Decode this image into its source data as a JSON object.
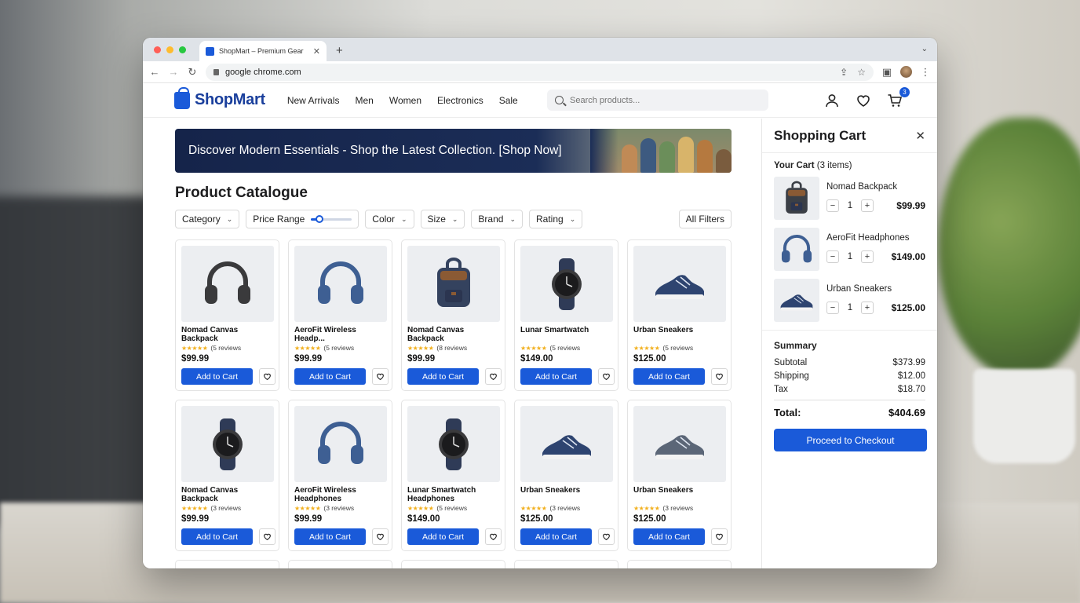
{
  "browser": {
    "tab_title": "ShopMart – Premium Gear",
    "tab_close": "✕",
    "new_tab": "+",
    "url": "google chrome.com"
  },
  "site": {
    "logo": "ShopMart",
    "nav": [
      "New Arrivals",
      "Men",
      "Women",
      "Electronics",
      "Sale"
    ],
    "search_placeholder": "Search products...",
    "cart_count": "3"
  },
  "banner": {
    "text": "Discover Modern Essentials - Shop the Latest Collection. [Shop Now]"
  },
  "catalogue": {
    "title": "Product Catalogue",
    "filters": [
      "Category",
      "Price Range",
      "Color",
      "Size",
      "Brand",
      "Rating"
    ],
    "price_range_level": 0.2,
    "all_filters": "All Filters",
    "add_to_cart": "Add to Cart",
    "products": [
      {
        "name": "Nomad Canvas Backpack",
        "reviews": "(5 reviews",
        "price": "$99.99",
        "img": "headphones",
        "color": "#3a3a3c"
      },
      {
        "name": "AeroFit Wireless Headp...",
        "reviews": "(5 reviews",
        "price": "$99.99",
        "img": "headphones",
        "color": "#3e5f93"
      },
      {
        "name": "Nomad Canvas Backpack",
        "reviews": "(8 reviews",
        "price": "$99.99",
        "img": "backpack",
        "color": "#34425e"
      },
      {
        "name": "Lunar Smartwatch",
        "reviews": "(5 reviews",
        "price": "$149.00",
        "img": "watch",
        "color": "#2f3b57"
      },
      {
        "name": "Urban Sneakers",
        "reviews": "(5 reviews",
        "price": "$125.00",
        "img": "sneaker",
        "color": "#2e4470"
      },
      {
        "name": "Nomad Canvas Backpack",
        "reviews": "(3 reviews",
        "price": "$99.99",
        "img": "watch",
        "color": "#2f3b57"
      },
      {
        "name": "AeroFit Wireless Headphones",
        "reviews": "(3 reviews",
        "price": "$99.99",
        "img": "headphones",
        "color": "#3e5f93"
      },
      {
        "name": "Lunar Smartwatch Headphones",
        "reviews": "(5 reviews",
        "price": "$149.00",
        "img": "watch",
        "color": "#2f3b57"
      },
      {
        "name": "Urban Sneakers",
        "reviews": "(3 reviews",
        "price": "$125.00",
        "img": "sneaker",
        "color": "#2e4470"
      },
      {
        "name": "Urban Sneakers",
        "reviews": "(3 reviews",
        "price": "$125.00",
        "img": "sneaker",
        "color": "#5b6677"
      }
    ]
  },
  "cart": {
    "title": "Shopping Cart",
    "your_cart": "Your Cart",
    "item_count": "(3 items)",
    "items": [
      {
        "name": "Nomad Backpack",
        "qty": "1",
        "price": "$99.99",
        "img": "backpack",
        "color": "#3b3f46"
      },
      {
        "name": "AeroFit Headphones",
        "qty": "1",
        "price": "$149.00",
        "img": "headphones",
        "color": "#3e5f93"
      },
      {
        "name": "Urban Sneakers",
        "qty": "1",
        "price": "$125.00",
        "img": "sneaker",
        "color": "#2e4470"
      }
    ],
    "summary_title": "Summary",
    "subtotal_label": "Subtotal",
    "subtotal": "$373.99",
    "shipping_label": "Shipping",
    "shipping": "$12.00",
    "tax_label": "Tax",
    "tax": "$18.70",
    "total_label": "Total:",
    "total": "$404.69",
    "checkout": "Proceed to Checkout"
  },
  "colors": {
    "accent": "#1a5ad9",
    "logo_text": "#1a3f9c",
    "banner_bg": "#15244a",
    "star": "#f2b01e"
  }
}
